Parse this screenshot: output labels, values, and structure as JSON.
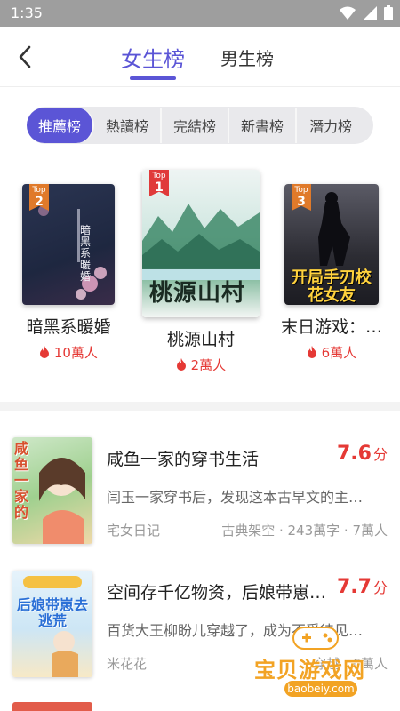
{
  "status": {
    "time": "1:35"
  },
  "header": {
    "tabs": [
      {
        "label": "女生榜",
        "active": true
      },
      {
        "label": "男生榜",
        "active": false
      }
    ]
  },
  "categories": [
    {
      "label": "推薦榜",
      "active": true
    },
    {
      "label": "熱讀榜",
      "active": false
    },
    {
      "label": "完結榜",
      "active": false
    },
    {
      "label": "新書榜",
      "active": false
    },
    {
      "label": "潛力榜",
      "active": false
    }
  ],
  "top3": [
    {
      "rank_label": "Top",
      "rank": "2",
      "title": "暗黑系暖婚",
      "popularity": "10萬人",
      "cover_title": "暗黑系暖婚"
    },
    {
      "rank_label": "Top",
      "rank": "1",
      "title": "桃源山村",
      "popularity": "2萬人",
      "cover_title": "桃源山村"
    },
    {
      "rank_label": "Top",
      "rank": "3",
      "title": "末日游戏：…",
      "popularity": "6萬人",
      "cover_title": "开局手刃校花女友"
    }
  ],
  "list": [
    {
      "title": "咸鱼一家的穿书生活",
      "score": "7.6",
      "score_unit": "分",
      "desc": "闫玉一家穿书后，发现这本古早文的主…",
      "author": "宅女日记",
      "meta": "古典架空 · 243萬字 · 7萬人",
      "cover_title": "咸鱼一家的"
    },
    {
      "title": "空间存千亿物资，后娘带崽…",
      "score": "7.7",
      "score_unit": "分",
      "desc": "百货大王柳盼儿穿越了，成为不受待见…",
      "author": "米花花",
      "meta": "穿越 · 6萬人",
      "cover_title": "后娘带崽去逃荒"
    }
  ],
  "watermark": {
    "text": "宝贝游戏网",
    "url": "baobeiy.com"
  },
  "colors": {
    "accent": "#5b55d6",
    "hot": "#e53935",
    "statusbar": "#9e9e9e"
  }
}
